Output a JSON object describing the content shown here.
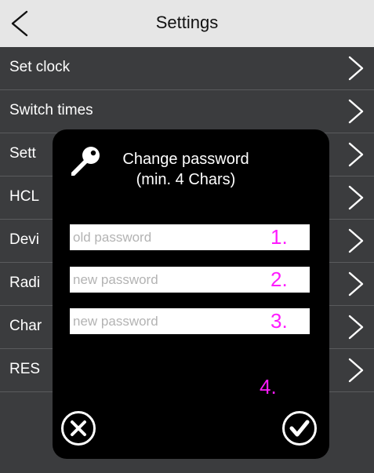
{
  "header": {
    "title": "Settings",
    "back_icon": "chevron-left-icon"
  },
  "menu": {
    "items": [
      {
        "label": "Set clock"
      },
      {
        "label": "Switch times"
      },
      {
        "label": "Sett"
      },
      {
        "label": "HCL"
      },
      {
        "label": "Devi"
      },
      {
        "label": "Radi"
      },
      {
        "label": "Char"
      },
      {
        "label": "RES"
      }
    ],
    "chevron_icon": "chevron-right-icon"
  },
  "dialog": {
    "icon": "key-icon",
    "title_line1": "Change password",
    "title_line2": "(min. 4 Chars)",
    "fields": [
      {
        "placeholder": "old password",
        "value": ""
      },
      {
        "placeholder": "new password",
        "value": ""
      },
      {
        "placeholder": "new password",
        "value": ""
      }
    ],
    "step_labels": [
      "1.",
      "2.",
      "3.",
      "4."
    ],
    "cancel_icon": "close-circle-icon",
    "confirm_icon": "check-circle-icon"
  },
  "colors": {
    "header_bg": "#e6e6e6",
    "list_bg": "#3b3c3e",
    "modal_bg": "#000000",
    "annotation": "#ff1aff"
  }
}
